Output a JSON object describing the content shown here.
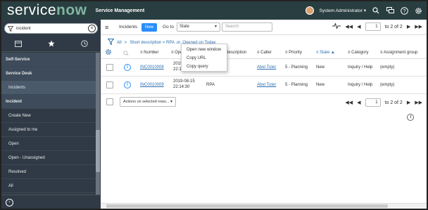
{
  "banner": {
    "logo_prefix": "service",
    "logo_suffix": "now",
    "app_name": "Service Management",
    "user_name": "System Administrator",
    "user_caret": "▾",
    "icons": [
      "search-icon",
      "chat-icon",
      "help-icon",
      "gear-icon"
    ]
  },
  "nav": {
    "filter_value": "incident",
    "tabs": [
      "all-apps-icon",
      "favorites-icon",
      "history-icon"
    ],
    "items": [
      {
        "label": "Self-Service",
        "type": "section"
      },
      {
        "label": "Service Desk",
        "type": "section"
      },
      {
        "label": "Incidents",
        "type": "active"
      },
      {
        "label": "Incident",
        "type": "section"
      },
      {
        "label": "Create New",
        "type": "sub"
      },
      {
        "label": "Assigned to me",
        "type": "sub"
      },
      {
        "label": "Open",
        "type": "sub"
      },
      {
        "label": "Open - Unassigned",
        "type": "sub"
      },
      {
        "label": "Resolved",
        "type": "sub"
      },
      {
        "label": "All",
        "type": "sub"
      }
    ]
  },
  "list": {
    "title": "Incidents",
    "new_label": "New",
    "goto_label": "Go to",
    "goto_field": "State",
    "search_placeholder": "Search",
    "page_value": "1",
    "page_total": "to 2 of 2",
    "breadcrumb_all": "All",
    "breadcrumb_sep": ">",
    "breadcrumb_filter": "Short description = RPA .or. Opened on Today",
    "columns": [
      "Number",
      "Opened",
      "Short description",
      "Caller",
      "Priority",
      "State",
      "Category",
      "Assignment group"
    ],
    "rows": [
      {
        "number": "INC0010008",
        "opened_date": "2019-08-15",
        "opened_time": "22:14:58",
        "short_description": "",
        "caller": "Abel Tuter",
        "priority": "5 - Planning",
        "state": "New",
        "category": "Inquiry / Help",
        "assignment_group": "(empty)"
      },
      {
        "number": "INC0010009",
        "opened_date": "2019-08-15",
        "opened_time": "22:14:30",
        "short_description": "RPA",
        "caller": "Abel Tuter",
        "priority": "5 - Planning",
        "state": "New",
        "category": "Inquiry / Help",
        "assignment_group": "(empty)"
      }
    ],
    "actions_placeholder": "Actions on selected rows...",
    "footer_page_value": "1",
    "footer_page_total": "to 2 of 2"
  },
  "context_menu": {
    "items": [
      "Open new window",
      "Copy URL",
      "Copy query"
    ]
  }
}
